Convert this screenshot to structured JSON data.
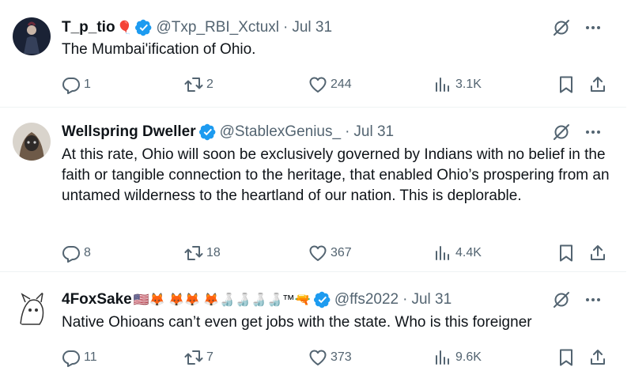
{
  "tweets": [
    {
      "display_name": "T_p_tio",
      "name_emoji": "🎈",
      "handle": "@Txp_RBI_Xctuxl",
      "dot": "·",
      "date": "Jul 31",
      "text": "The Mumbai'ification of Ohio.",
      "replies": "1",
      "reposts": "2",
      "likes": "244",
      "views": "3.1K"
    },
    {
      "display_name": "Wellspring Dweller",
      "name_emoji": "",
      "handle": "@StablexGenius_",
      "dot": "·",
      "date": "Jul 31",
      "text": "At this rate, Ohio will soon be exclusively governed by Indians with no belief in the faith or tangible connection to the heritage, that enabled Ohio’s prospering from an untamed wilderness to the heartland of our nation. This is deplorable.",
      "replies": "8",
      "reposts": "18",
      "likes": "367",
      "views": "4.4K"
    },
    {
      "display_name": "4FoxSake",
      "name_emoji": "🇺🇸🦊 🦊🦊 🦊🍶🍶🍶🍶™🔫",
      "handle": "@ffs2022",
      "dot": "·",
      "date": "Jul 31",
      "text": "Native Ohioans can’t even get jobs with the state. Who is this foreigner",
      "replies": "11",
      "reposts": "7",
      "likes": "373",
      "views": "9.6K"
    }
  ],
  "icons": {
    "verified_color": "#1d9bf0",
    "action_color": "#536471",
    "grok": "grok-icon",
    "more": "more-icon",
    "reply": "reply-icon",
    "repost": "repost-icon",
    "like": "like-icon",
    "views": "views-icon",
    "bookmark": "bookmark-icon",
    "share": "share-icon"
  }
}
